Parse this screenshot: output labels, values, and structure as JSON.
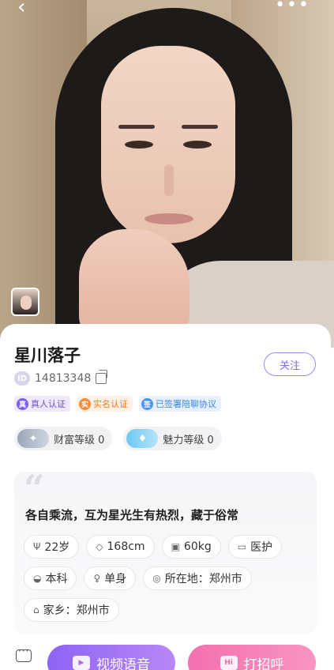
{
  "header": {
    "back_icon": "chevron-left-icon",
    "more_icon": "more-horizontal-icon"
  },
  "profile": {
    "name": "星川落子",
    "id_badge": "ID",
    "id_value": "14813348",
    "follow_label": "关注",
    "verifications": [
      {
        "icon": "真",
        "label": "真人认证"
      },
      {
        "icon": "实",
        "label": "实名认证"
      },
      {
        "icon": "签",
        "label": "已签署陪聊协议"
      }
    ],
    "levels": [
      {
        "label": "财富等级 0"
      },
      {
        "label": "魅力等级 0"
      }
    ],
    "bio": "各自乘流，互为星光生有热烈，藏于俗常",
    "attributes": [
      {
        "icon": "Ψ",
        "text": "22岁"
      },
      {
        "icon": "◇",
        "text": "168cm"
      },
      {
        "icon": "▣",
        "text": "60kg"
      },
      {
        "icon": "▭",
        "text": "医护"
      },
      {
        "icon": "◒",
        "text": "本科"
      },
      {
        "icon": "♀",
        "text": "单身"
      },
      {
        "icon": "◎",
        "text": "所在地：郑州市"
      },
      {
        "icon": "⌂",
        "text": "家乡：郑州市"
      }
    ]
  },
  "actions": {
    "video_label": "视频语音",
    "greet_label": "打招呼",
    "greet_badge": "Hi"
  }
}
